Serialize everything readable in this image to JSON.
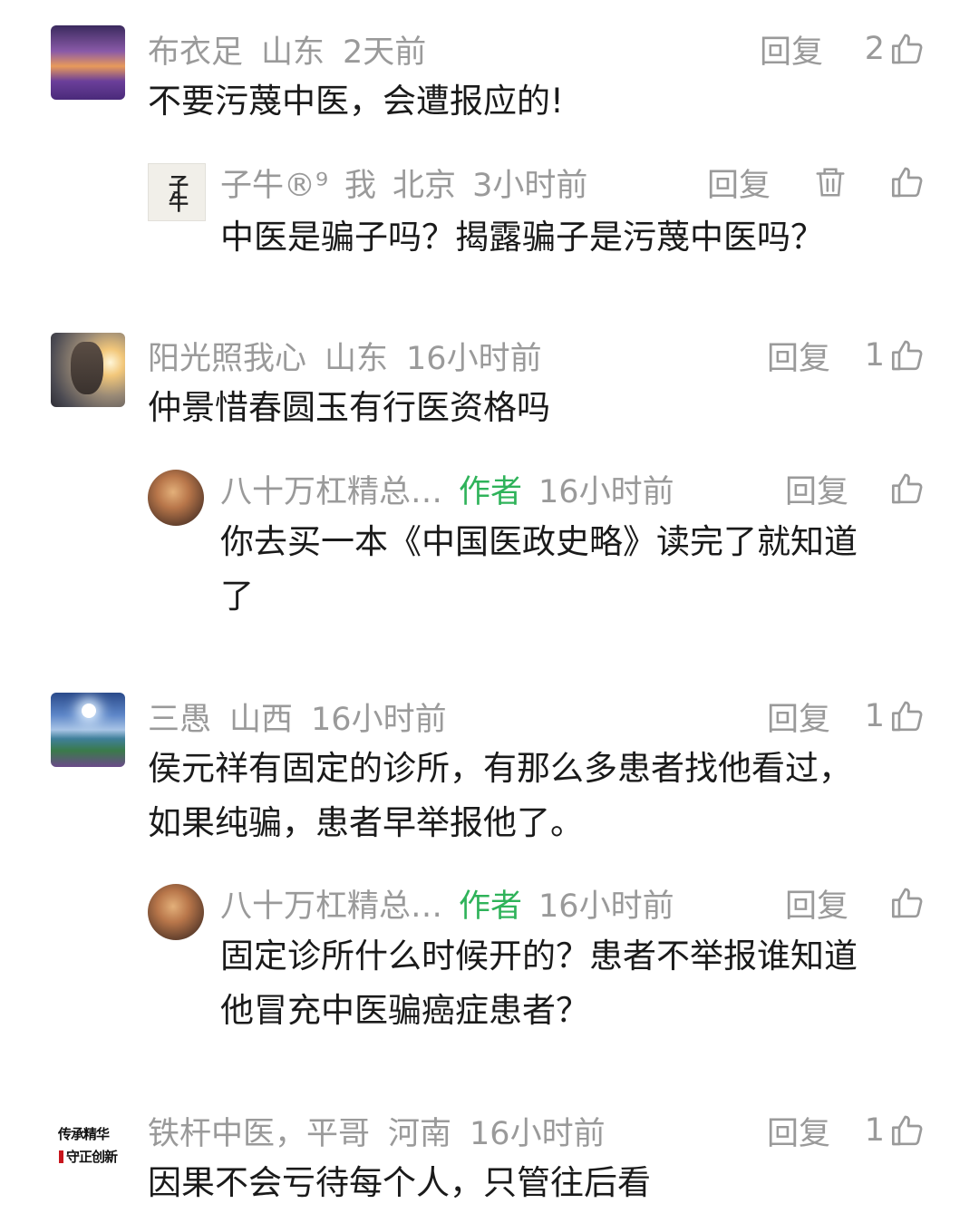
{
  "comments": [
    {
      "name": "布衣足",
      "location": "山东",
      "time": "2天前",
      "reply_label": "回复",
      "likes": "2",
      "text": "不要污蔑中医，会遭报应的!",
      "reply": {
        "name": "子牛®⁹",
        "me": "我",
        "location": "北京",
        "time": "3小时前",
        "reply_label": "回复",
        "text": "中医是骗子吗？揭露骗子是污蔑中医吗？",
        "avatar_text": "子牛"
      }
    },
    {
      "name": "阳光照我心",
      "location": "山东",
      "time": "16小时前",
      "reply_label": "回复",
      "likes": "1",
      "text": "仲景惜春圆玉有行医资格吗",
      "reply": {
        "name": "八十万杠精总…",
        "author_tag": "作者",
        "time": "16小时前",
        "reply_label": "回复",
        "text_line1": "你去买一本《中国医政史略》读完了就知道",
        "text_line2": "了"
      }
    },
    {
      "name": "三愚",
      "location": "山西",
      "time": "16小时前",
      "reply_label": "回复",
      "likes": "1",
      "text_line1": "侯元祥有固定的诊所，有那么多患者找他看过，",
      "text_line2": "如果纯骗，患者早举报他了。",
      "reply": {
        "name": "八十万杠精总…",
        "author_tag": "作者",
        "time": "16小时前",
        "reply_label": "回复",
        "text_line1": "固定诊所什么时候开的？患者不举报谁知道",
        "text_line2": "他冒充中医骗癌症患者？"
      }
    },
    {
      "name": "铁杆中医，平哥",
      "location": "河南",
      "time": "16小时前",
      "reply_label": "回复",
      "likes": "1",
      "text": "因果不会亏待每个人，只管往后看",
      "avatar_text_1": "传承精华",
      "avatar_text_2": "守正创新"
    }
  ],
  "colors": {
    "meta_gray": "#9a9a9a",
    "author_green": "#2fb35a",
    "text": "#1a1a1a"
  }
}
